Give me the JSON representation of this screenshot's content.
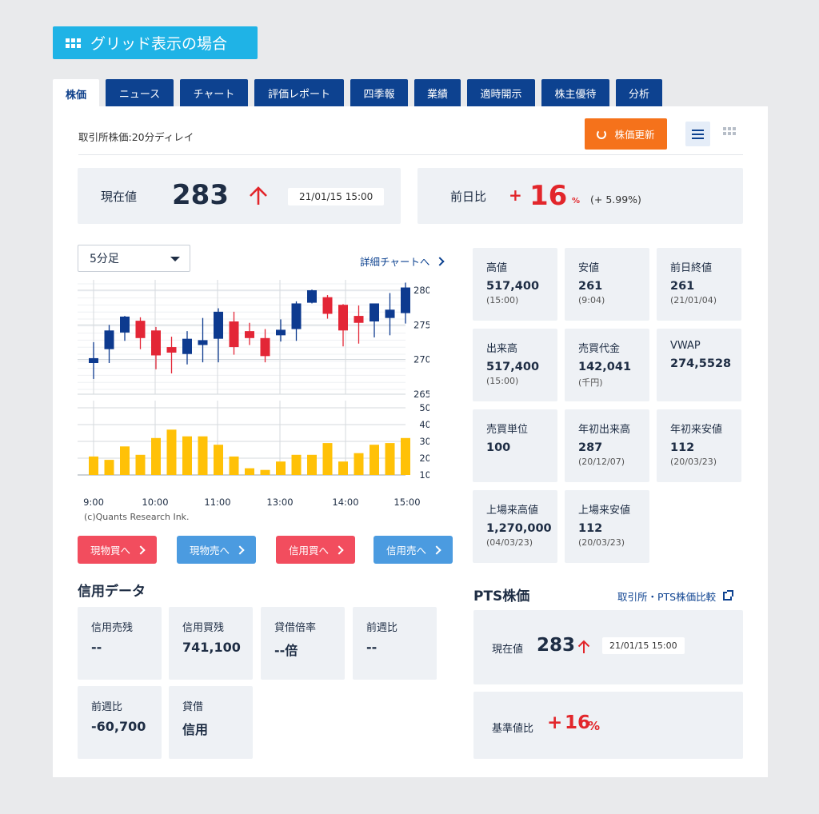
{
  "banner": {
    "label": "グリッド表示の場合",
    "icon": "grid-icon"
  },
  "tabs": [
    "株価",
    "ニュース",
    "チャート",
    "評価レポート",
    "四季報",
    "業績",
    "適時開示",
    "株主優待",
    "分析"
  ],
  "header": {
    "delay_note": "取引所株価:20分ディレイ",
    "refresh_label": "株価更新",
    "accent_color": "#f5721b"
  },
  "price": {
    "label": "現在値",
    "value": "283",
    "timestamp": "21/01/15 15:00",
    "direction": "up"
  },
  "change": {
    "label": "前日比",
    "sign": "+",
    "value": "16",
    "unit": "%",
    "detail": "(+ 5.99%)",
    "color": "#e2262b"
  },
  "chart": {
    "interval_value": "5分足",
    "detail_link": "詳細チャートへ",
    "credit": "(c)Quants Research Ink."
  },
  "chart_data": {
    "type": "candlestick+bar",
    "x_labels": [
      "9:00",
      "10:00",
      "11:00",
      "13:00",
      "14:00",
      "15:00"
    ],
    "price_axis": {
      "ticks": [
        "280",
        "275",
        "270",
        "265"
      ],
      "range": [
        265,
        281.5
      ]
    },
    "volume_axis": {
      "ticks": [
        "50",
        "40",
        "30",
        "20",
        "10"
      ],
      "range": [
        10,
        50
      ]
    },
    "up_color": "#0d3a8f",
    "down_color": "#e32636",
    "volume_color": "#ffc107",
    "candles": [
      {
        "open": 269.5,
        "high": 272.5,
        "low": 267.2,
        "close": 270.2
      },
      {
        "open": 271.5,
        "high": 275.0,
        "low": 269.5,
        "close": 274.2
      },
      {
        "open": 273.9,
        "high": 276.3,
        "low": 272.7,
        "close": 276.2
      },
      {
        "open": 275.6,
        "high": 276.1,
        "low": 271.5,
        "close": 273.1
      },
      {
        "open": 274.2,
        "high": 274.7,
        "low": 268.6,
        "close": 270.6
      },
      {
        "open": 271.8,
        "high": 273.3,
        "low": 268.0,
        "close": 271.0
      },
      {
        "open": 270.8,
        "high": 274.1,
        "low": 269.3,
        "close": 273.0
      },
      {
        "open": 272.1,
        "high": 276.0,
        "low": 269.6,
        "close": 272.8
      },
      {
        "open": 273.0,
        "high": 277.4,
        "low": 269.6,
        "close": 276.9
      },
      {
        "open": 275.5,
        "high": 276.9,
        "low": 270.7,
        "close": 271.8
      },
      {
        "open": 274.1,
        "high": 275.3,
        "low": 272.1,
        "close": 273.1
      },
      {
        "open": 273.1,
        "high": 274.4,
        "low": 269.6,
        "close": 270.5
      },
      {
        "open": 273.5,
        "high": 275.8,
        "low": 272.6,
        "close": 274.3
      },
      {
        "open": 274.4,
        "high": 278.4,
        "low": 272.7,
        "close": 278.1
      },
      {
        "open": 278.2,
        "high": 280.1,
        "low": 278.1,
        "close": 280.0
      },
      {
        "open": 279.0,
        "high": 279.3,
        "low": 275.9,
        "close": 276.6
      },
      {
        "open": 277.9,
        "high": 278.0,
        "low": 271.9,
        "close": 274.2
      },
      {
        "open": 276.3,
        "high": 277.8,
        "low": 272.3,
        "close": 275.3
      },
      {
        "open": 275.5,
        "high": 277.7,
        "low": 273.2,
        "close": 278.1
      },
      {
        "open": 276.0,
        "high": 279.6,
        "low": 273.5,
        "close": 277.2
      },
      {
        "open": 276.7,
        "high": 281.1,
        "low": 275.2,
        "close": 280.4
      }
    ],
    "volumes": [
      21,
      19,
      27,
      22,
      32,
      37,
      33,
      33,
      28,
      21,
      14,
      13,
      18,
      22,
      22,
      29,
      18,
      23,
      28,
      29,
      32
    ]
  },
  "trade_buttons": [
    {
      "label": "現物買へ",
      "color": "#f24d5e"
    },
    {
      "label": "現物売へ",
      "color": "#4b9be0"
    },
    {
      "label": "信用買へ",
      "color": "#f24d5e"
    },
    {
      "label": "信用売へ",
      "color": "#4b9be0"
    }
  ],
  "stats": [
    {
      "label": "高値",
      "value": "517,400",
      "sub": "(15:00)"
    },
    {
      "label": "安値",
      "value": "261",
      "sub": "(9:04)"
    },
    {
      "label": "前日終値",
      "value": "261",
      "sub": "(21/01/04)"
    },
    {
      "label": "出来高",
      "value": "517,400",
      "sub": "(15:00)"
    },
    {
      "label": "売買代金",
      "value": "142,041",
      "sub": "(千円)"
    },
    {
      "label": "VWAP",
      "value": "274,5528",
      "sub": ""
    },
    {
      "label": "売買単位",
      "value": "100",
      "sub": ""
    },
    {
      "label": "年初出来高",
      "value": "287",
      "sub": "(20/12/07)"
    },
    {
      "label": "年初来安値",
      "value": "112",
      "sub": "(20/03/23)"
    },
    {
      "label": "上場来高値",
      "value": "1,270,000",
      "sub": "(04/03/23)"
    },
    {
      "label": "上場来安値",
      "value": "112",
      "sub": "(20/03/23)"
    }
  ],
  "credit": {
    "title": "信用データ",
    "items": [
      {
        "label": "信用売残",
        "value": "--"
      },
      {
        "label": "信用買残",
        "value": "741,100"
      },
      {
        "label": "貸借倍率",
        "value": "--倍"
      },
      {
        "label": "前週比",
        "value": "--"
      },
      {
        "label": "前週比",
        "value": "-60,700"
      },
      {
        "label": "貸借",
        "value": "信用"
      }
    ]
  },
  "pts": {
    "title": "PTS株価",
    "compare_link": "取引所・PTS株価比較",
    "current_label": "現在値",
    "current_value": "283",
    "timestamp": "21/01/15 15:00",
    "base_label": "基準値比",
    "base_sign": "+",
    "base_value": "16",
    "base_unit": "%"
  }
}
